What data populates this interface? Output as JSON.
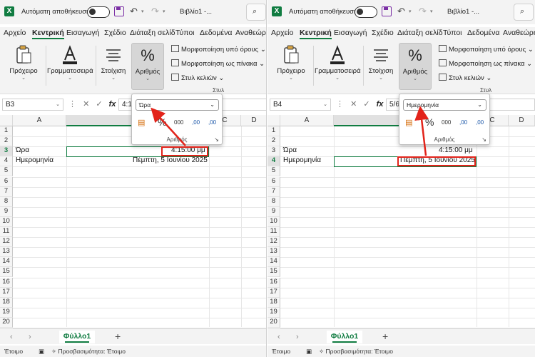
{
  "panels": {
    "left": {
      "name_box": "B3",
      "formula_value": "4:1",
      "selected_column": "B",
      "selected_row": 3,
      "format_value": "Ώρα"
    },
    "right": {
      "name_box": "B4",
      "formula_value": "5/6",
      "selected_column": "B",
      "selected_row": 4,
      "format_value": "Ημερομηνία"
    }
  },
  "titlebar": {
    "autosave_label": "Αυτόματη αποθήκευση",
    "doc_title": "Βιβλίο1 -..."
  },
  "tabs": [
    "Αρχείο",
    "Κεντρική",
    "Εισαγωγή",
    "Σχέδιο",
    "Διάταξη σελίδ",
    "Τύποι",
    "Δεδομένα",
    "Αναθεώρη"
  ],
  "active_tab": "Κεντρική",
  "ribbon": {
    "clipboard": "Πρόχειρο",
    "font": "Γραμματοσειρά",
    "alignment": "Στοίχιση",
    "number": "Αριθμός",
    "conditional_format": "Μορφοποίηση υπό όρους",
    "format_as_table": "Μορφοποίηση ως πίνακα",
    "cell_styles": "Στυλ κελιών",
    "styles_group": "Στυλ"
  },
  "number_dropdown": {
    "group_label": "Αριθμός",
    "percent": "%",
    "thousands": "000",
    "increase_decimal": ",00",
    "decrease_decimal": ",00"
  },
  "columns": [
    "A",
    "B",
    "C",
    "D"
  ],
  "rows": [
    "1",
    "2",
    "3",
    "4",
    "5",
    "6",
    "7",
    "8",
    "9",
    "10",
    "11",
    "12",
    "13",
    "14",
    "15",
    "16",
    "17",
    "18",
    "19",
    "20"
  ],
  "cells": {
    "a3": "Ώρα",
    "a4": "Ημερομηνία",
    "b3": "4:15:00 μμ",
    "b4": "Πέμπτη, 5 Ιουνίου 2025"
  },
  "sheet": {
    "tab": "Φύλλο1",
    "add": "+"
  },
  "status": {
    "ready": "Έτοιμο",
    "accessibility": "Προσβασιμότητα: Έτοιμο"
  },
  "colors": {
    "excel_green": "#107c41",
    "highlight_red": "#e2231a"
  },
  "icons": {
    "excel_logo": "X",
    "undo": "↶",
    "redo": "↷",
    "search": "⌕",
    "fx": "fx"
  }
}
